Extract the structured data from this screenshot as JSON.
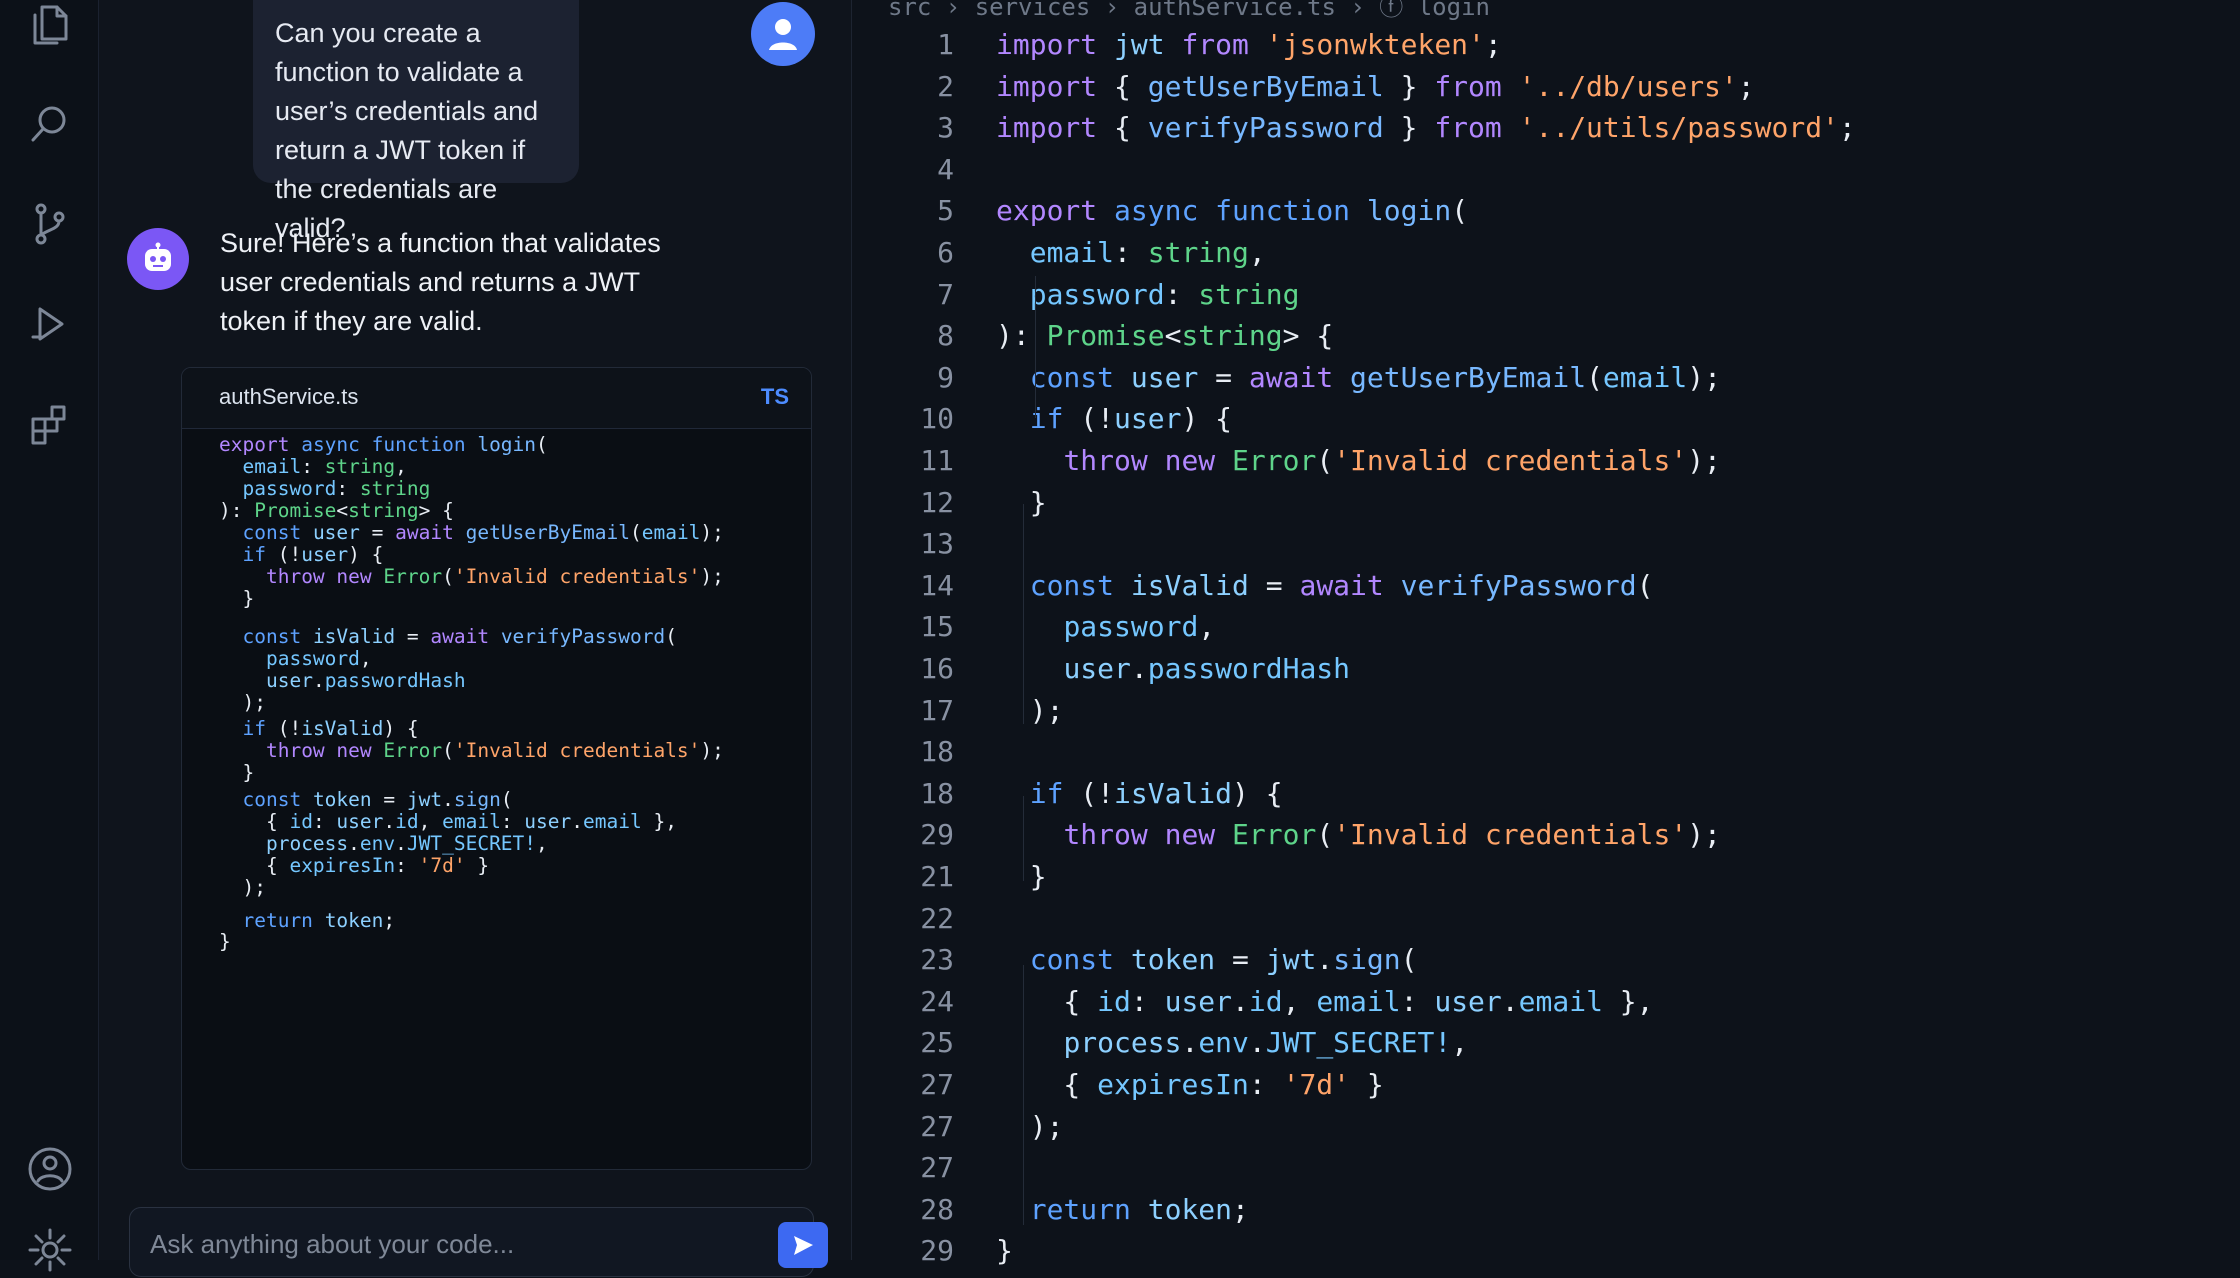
{
  "chat": {
    "user_message": "Can you create a function to validate a user’s credentials and return a JWT token if the credentials are valid?",
    "assistant_message": "Sure! Here’s a function that validates user credentials and returns a JWT token if they are valid.",
    "code_card": {
      "filename": "authService.ts",
      "language": "TS",
      "lines": [
        "export async function login(",
        "  email: string,",
        "  password: string",
        "): Promise<string> {",
        "  const user = await getUserByEmail(email);",
        "  if (!user) {",
        "    throw new Error('Invalid credentials');",
        "  }",
        "",
        "  const isValid = await verifyPassword(",
        "    password,",
        "    user.passwordHash",
        "  );",
        "  if (!isValid) {",
        "    throw new Error('Invalid credentials');",
        "  }",
        "  const token = jwt.sign(",
        "    { id: user.id, email: user.email },",
        "    process.env.JWT_SECRET!,",
        "    { expiresIn: '7d' }",
        "  );",
        "  return token;",
        "}"
      ]
    },
    "composer_placeholder": "Ask anything about your code..."
  },
  "editor": {
    "breadcrumb": "src › services › authService.ts › ⓕ login",
    "line_numbers": [
      "1",
      "2",
      "3",
      "4",
      "5",
      "6",
      "7",
      "8",
      "9",
      "10",
      "11",
      "12",
      "13",
      "14",
      "15",
      "16",
      "17",
      "18",
      "18",
      "29",
      "21",
      "22",
      "23",
      "24",
      "25",
      "27",
      "27",
      "27",
      "28",
      "29"
    ],
    "lines": [
      "import jwt from 'jsonwkteken';",
      "import { getUserByEmail } from '../db/users';",
      "import { verifyPassword } from '../utils/password';",
      "",
      "export async function login(",
      "  email: string,",
      "  password: string",
      "): Promise<string> {",
      "  const user = await getUserByEmail(email);",
      "  if (!user) {",
      "    throw new Error('Invalid credentials');",
      "  }",
      "",
      "  const isValid = await verifyPassword(",
      "    password,",
      "    user.passwordHash",
      "  );",
      "",
      "  if (!isValid) {",
      "    throw new Error('Invalid credentials');",
      "  }",
      "",
      "  const token = jwt.sign(",
      "    { id: user.id, email: user.email },",
      "    process.env.JWT_SECRET!,",
      "    { expiresIn: '7d' }",
      "  );",
      "",
      "  return token;",
      "}"
    ]
  },
  "icons": {
    "activity_bar": [
      "files-icon",
      "search-icon",
      "source-control-icon",
      "run-debug-icon",
      "extensions-icon",
      "account-icon",
      "settings-icon"
    ],
    "chat": [
      "user-avatar-icon",
      "bot-avatar-icon",
      "send-icon"
    ]
  },
  "colors": {
    "background": "#0d121a",
    "panel": "#0f141c",
    "accent": "#4d7cf7",
    "bot": "#7b57f5",
    "keyword": "#b287ff",
    "function": "#78b8ff",
    "string": "#ffa469",
    "type": "#5ed48a"
  }
}
